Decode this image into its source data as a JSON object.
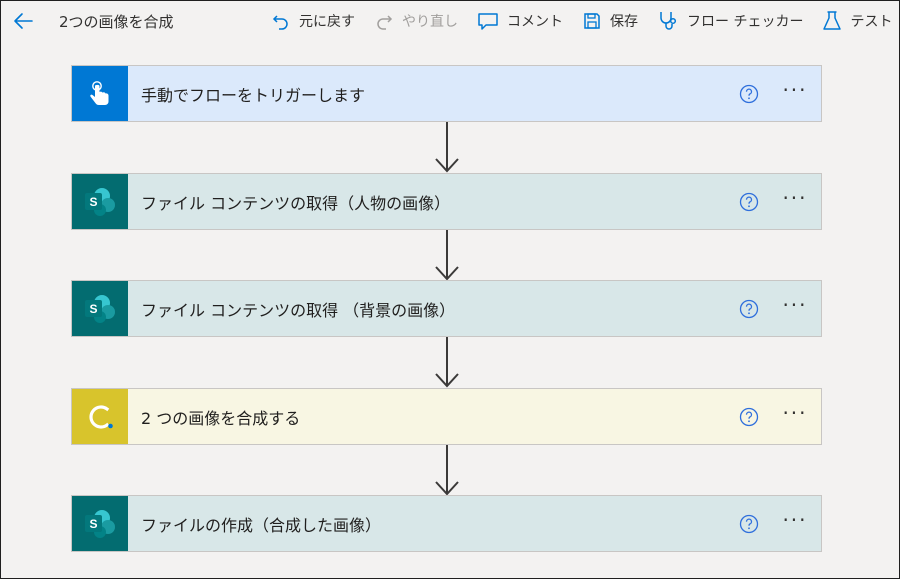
{
  "header": {
    "title": "2つの画像を合成",
    "undo_label": "元に戻す",
    "redo_label": "やり直し",
    "comment_label": "コメント",
    "save_label": "保存",
    "flow_checker_label": "フロー チェッカー",
    "test_label": "テスト"
  },
  "steps": [
    {
      "label": "手動でフローをトリガーします",
      "icon": "manual-trigger-icon",
      "color": "#0078d4",
      "bg": "#dbe9fb"
    },
    {
      "label": "ファイル コンテンツの取得（人物の画像）",
      "icon": "sharepoint-icon",
      "color": "#036c70",
      "bg": "#d8e7e8"
    },
    {
      "label": "ファイル コンテンツの取得 （背景の画像）",
      "icon": "sharepoint-icon",
      "color": "#036c70",
      "bg": "#d8e7e8"
    },
    {
      "label": "2 つの画像を合成する",
      "icon": "custom-connector-icon",
      "color": "#d8c42c",
      "bg": "#f8f6e3"
    },
    {
      "label": "ファイルの作成（合成した画像）",
      "icon": "sharepoint-icon",
      "color": "#036c70",
      "bg": "#d8e7e8"
    }
  ],
  "colors": {
    "accent": "#0078d4",
    "help_icon": "#2f6fdc"
  }
}
